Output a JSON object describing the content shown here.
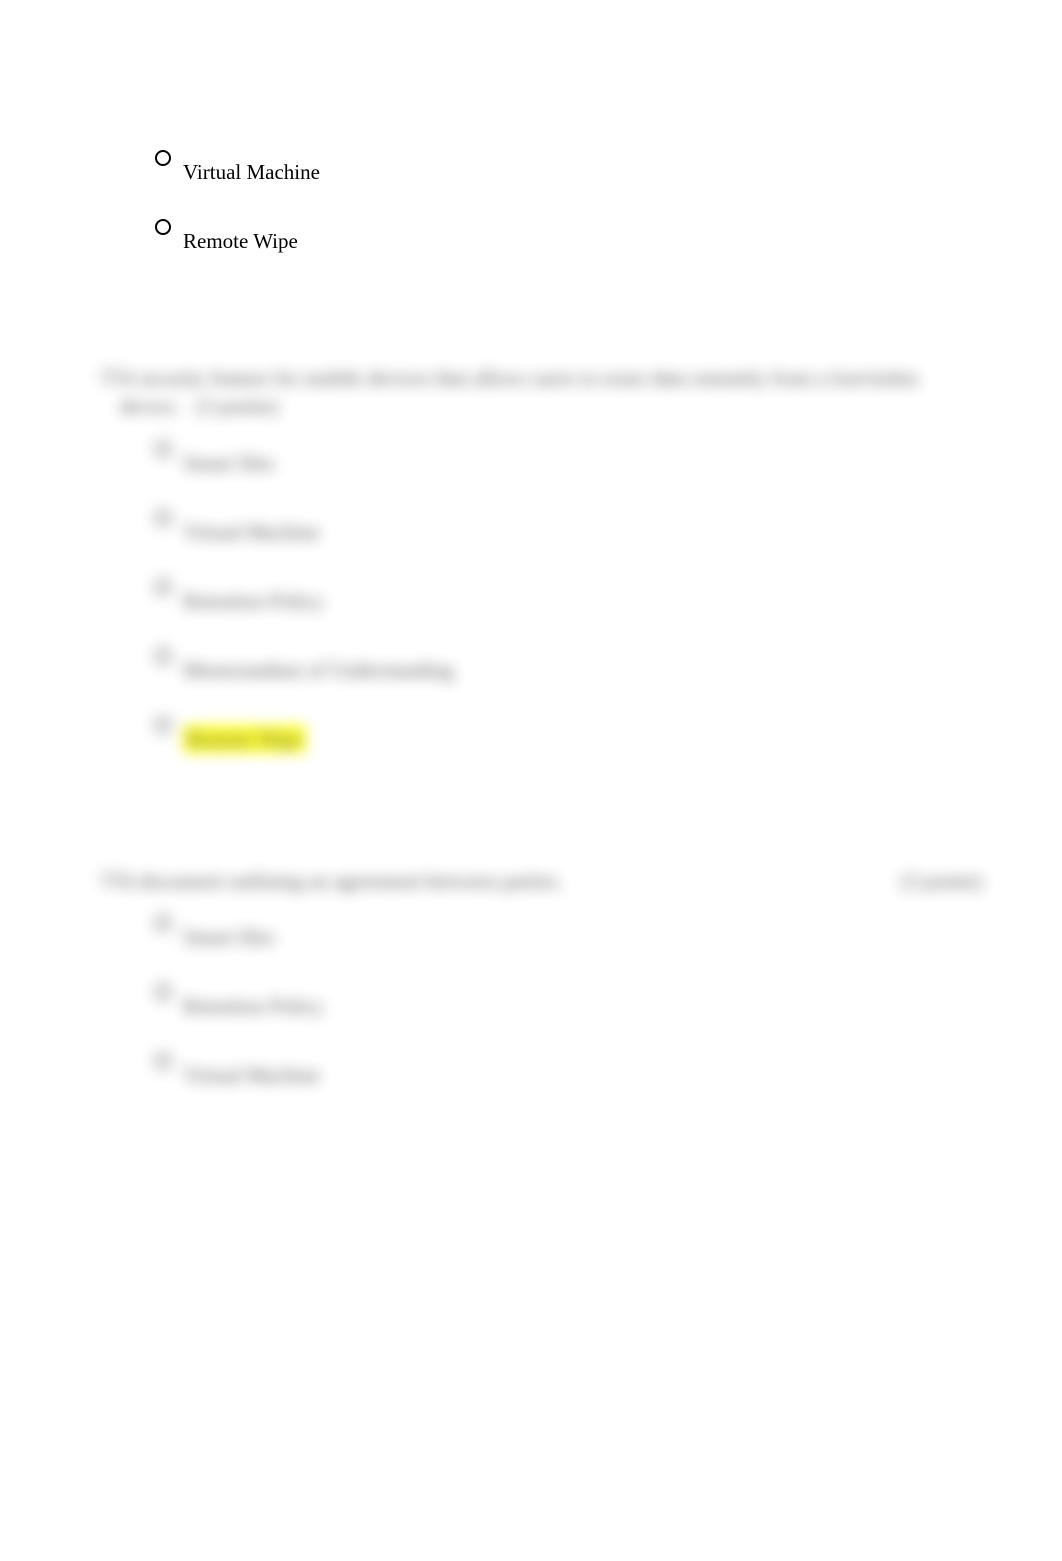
{
  "top_fragment": {
    "options": [
      "Virtual Machine",
      "Remote Wipe"
    ]
  },
  "q2": {
    "number": "12.",
    "prompt": "A security feature for mobile devices that allows users to erase data remotely from a lost/stolen device.",
    "points": "(3 points)",
    "options": [
      "Smart files",
      "Virtual Machine",
      "Retention Policy",
      "Memorandum of Understanding",
      "Remote Wipe"
    ],
    "highlighted_index": 4
  },
  "q3": {
    "number": "13.",
    "prompt": "A document outlining an agreement between parties.",
    "points": "(3 points)",
    "options": [
      "Smart files",
      "Retention Policy",
      "Virtual Machine"
    ]
  }
}
